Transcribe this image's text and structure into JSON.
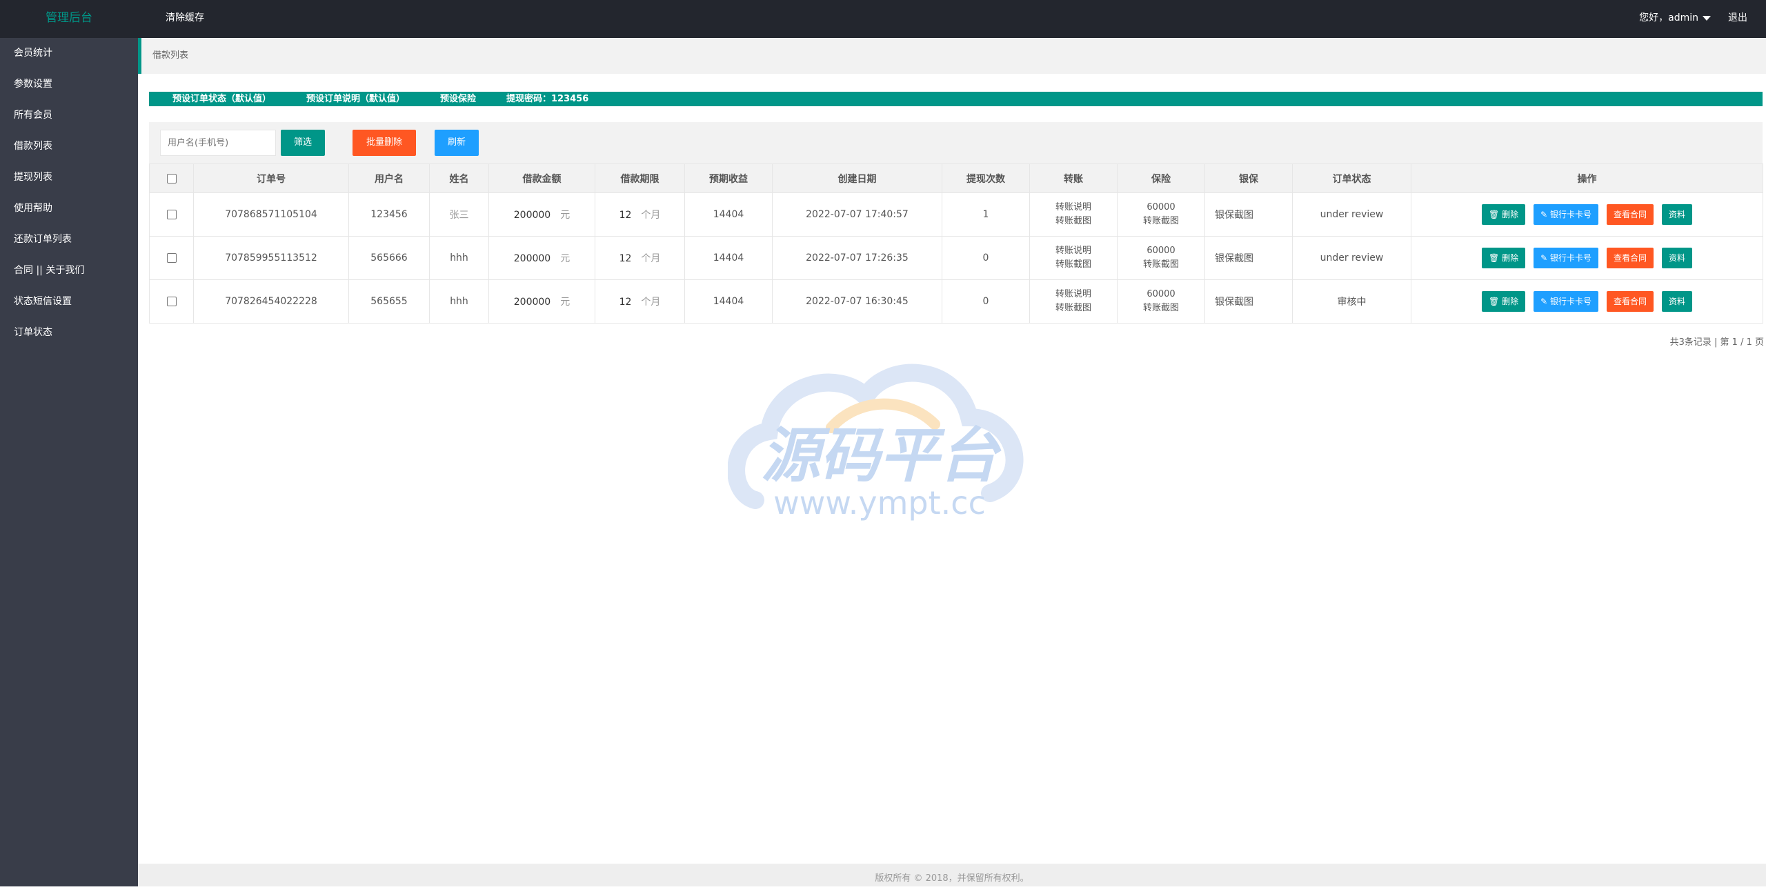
{
  "header": {
    "logo": "管理后台",
    "clear_cache": "清除缓存",
    "user": "您好，admin",
    "logout": "退出"
  },
  "sidebar": {
    "items": [
      {
        "label": "会员统计"
      },
      {
        "label": "参数设置"
      },
      {
        "label": "所有会员"
      },
      {
        "label": "借款列表"
      },
      {
        "label": "提现列表"
      },
      {
        "label": "使用帮助"
      },
      {
        "label": "还款订单列表"
      },
      {
        "label": "合同 || 关于我们"
      },
      {
        "label": "状态短信设置"
      },
      {
        "label": "订单状态"
      }
    ]
  },
  "breadcrumb": "借款列表",
  "preset": {
    "status": "预设订单状态（默认值）",
    "desc": "预设订单说明（默认值）",
    "insurance": "预设保险",
    "password": "提现密码：123456"
  },
  "filter": {
    "placeholder": "用户名(手机号)",
    "filter_btn": "筛选",
    "batch_delete": "批量删除",
    "refresh": "刷新"
  },
  "table": {
    "headers": [
      "订单号",
      "用户名",
      "姓名",
      "借款金额",
      "借款期限",
      "预期收益",
      "创建日期",
      "提现次数",
      "转账",
      "保险",
      "银保",
      "订单状态",
      "操作"
    ],
    "rows": [
      {
        "order": "707868571105104",
        "user": "123456",
        "name": "张三",
        "amount": "200000",
        "unit": "元",
        "term": "12",
        "term_unit": "个月",
        "income": "14404",
        "date": "2022-07-07 17:40:57",
        "withdraw": "1",
        "transfer1": "转账说明",
        "transfer2": "转账截图",
        "ins1": "60000",
        "ins2": "转账截图",
        "bank": "银保截图",
        "status": "under review"
      },
      {
        "order": "707859955113512",
        "user": "565666",
        "name": "hhh",
        "amount": "200000",
        "unit": "元",
        "term": "12",
        "term_unit": "个月",
        "income": "14404",
        "date": "2022-07-07 17:26:35",
        "withdraw": "0",
        "transfer1": "转账说明",
        "transfer2": "转账截图",
        "ins1": "60000",
        "ins2": "转账截图",
        "bank": "银保截图",
        "status": "under review"
      },
      {
        "order": "707826454022228",
        "user": "565655",
        "name": "hhh",
        "amount": "200000",
        "unit": "元",
        "term": "12",
        "term_unit": "个月",
        "income": "14404",
        "date": "2022-07-07 16:30:45",
        "withdraw": "0",
        "transfer1": "转账说明",
        "transfer2": "转账截图",
        "ins1": "60000",
        "ins2": "转账截图",
        "bank": "银保截图",
        "status": "审核中"
      }
    ],
    "actions": {
      "delete": "删除",
      "bank_card": "银行卡卡号",
      "contract": "查看合同",
      "info": "资料"
    }
  },
  "pager": "共3条记录 | 第 1 / 1 页",
  "watermark": {
    "title": "源码平台",
    "url": "www.ympt.cc"
  },
  "footer": "版权所有 © 2018，并保留所有权利。",
  "colors": {
    "accent": "#009688",
    "danger": "#ff5722",
    "info": "#1e9fff",
    "header": "#23262e",
    "sidebar": "#393d49"
  }
}
